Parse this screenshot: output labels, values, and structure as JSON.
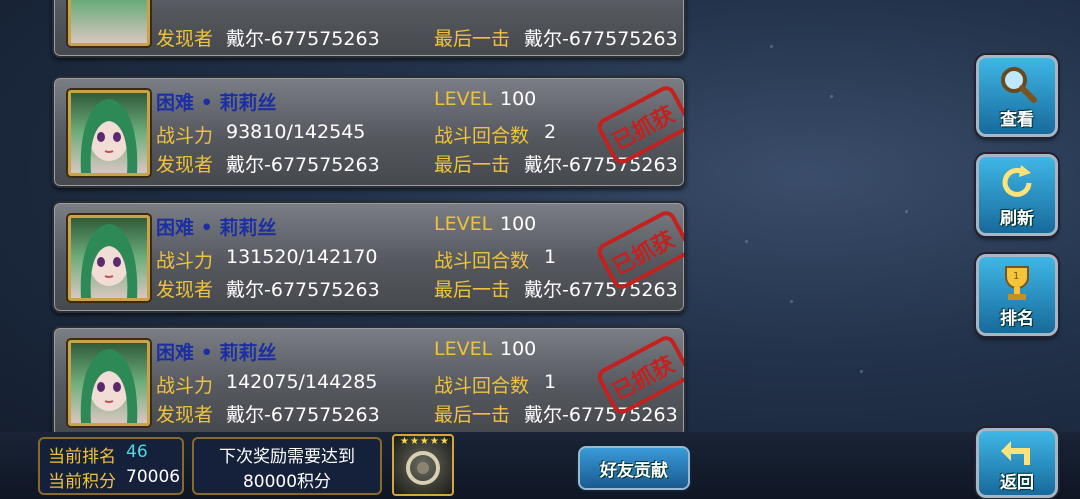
{
  "cards": [
    {
      "partial": true,
      "finder_label": "发现者",
      "finder_value": "戴尔-677575263",
      "lasthit_label": "最后一击",
      "lasthit_value": "戴尔-677575263"
    },
    {
      "name": "困难 • 莉莉丝",
      "level_label": "LEVEL",
      "level_value": "100",
      "power_label": "战斗力",
      "power_value": "93810/142545",
      "rounds_label": "战斗回合数",
      "rounds_value": "2",
      "finder_label": "发现者",
      "finder_value": "戴尔-677575263",
      "lasthit_label": "最后一击",
      "lasthit_value": "戴尔-677575263",
      "stamp": "已抓获"
    },
    {
      "name": "困难 • 莉莉丝",
      "level_label": "LEVEL",
      "level_value": "100",
      "power_label": "战斗力",
      "power_value": "131520/142170",
      "rounds_label": "战斗回合数",
      "rounds_value": "1",
      "finder_label": "发现者",
      "finder_value": "戴尔-677575263",
      "lasthit_label": "最后一击",
      "lasthit_value": "戴尔-677575263",
      "stamp": "已抓获"
    },
    {
      "name": "困难 • 莉莉丝",
      "level_label": "LEVEL",
      "level_value": "100",
      "power_label": "战斗力",
      "power_value": "142075/144285",
      "rounds_label": "战斗回合数",
      "rounds_value": "1",
      "finder_label": "发现者",
      "finder_value": "戴尔-677575263",
      "lasthit_label": "最后一击",
      "lasthit_value": "戴尔-677575263",
      "stamp": "已抓获"
    }
  ],
  "side_buttons": {
    "view": {
      "label": "查看",
      "icon": "magnifier-icon"
    },
    "refresh": {
      "label": "刷新",
      "icon": "refresh-icon"
    },
    "rank": {
      "label": "排名",
      "icon": "trophy-icon"
    },
    "back": {
      "label": "返回",
      "icon": "return-arrow-icon"
    }
  },
  "bottom": {
    "rank_label": "当前排名",
    "rank_value": "46",
    "score_label": "当前积分",
    "score_value": "70006",
    "next_reward_line1": "下次奖励需要达到",
    "next_reward_line2": "80000积分",
    "reward_stars": 5,
    "friend_button": "好友贡献"
  },
  "colors": {
    "name": "#1b2fa3",
    "label": "#f0c23a",
    "value": "#ffffff",
    "rank_value": "#3fe0e0",
    "stamp": "#c4201e"
  }
}
